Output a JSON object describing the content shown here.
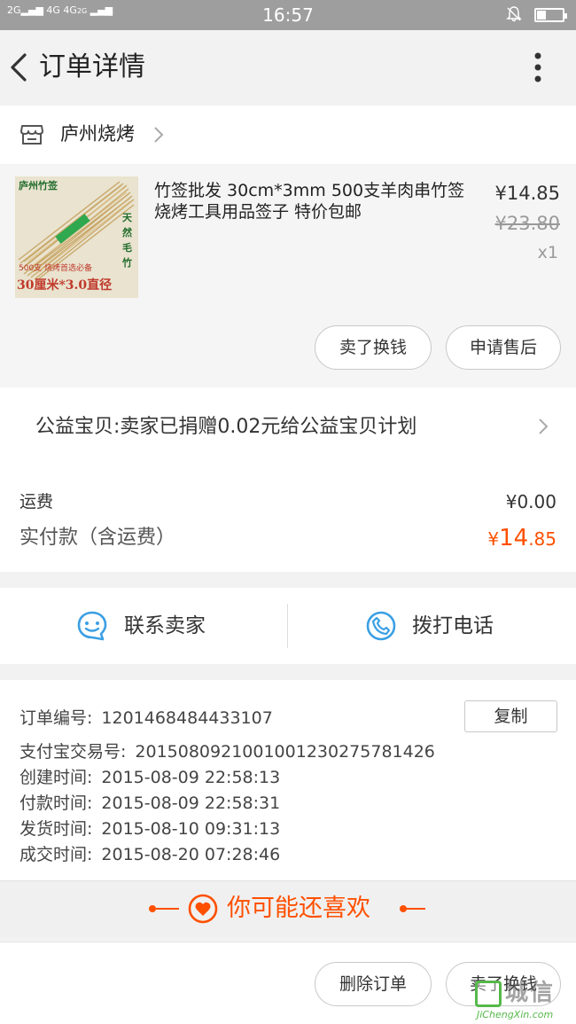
{
  "status_bar": {
    "signal_left": "2G",
    "network": "4G 4G",
    "network_sub": "2G",
    "time": "16:57",
    "battery_level": 0.35
  },
  "header": {
    "title": "订单详情"
  },
  "shop": {
    "name": "庐州烧烤"
  },
  "product": {
    "image_text": {
      "brand": "庐州竹签",
      "side": "天然毛竹",
      "count_line": "500支  烧烤首选必备",
      "size_line": "30厘米*3.0直径"
    },
    "name": "竹签批发 30cm*3mm 500支羊肉串竹签烧烤工具用品签子 特价包邮",
    "price": "¥14.85",
    "original_price": "¥23.80",
    "quantity": "x1",
    "buttons": {
      "sell": "卖了换钱",
      "after_sale": "申请售后"
    }
  },
  "charity": {
    "text": "公益宝贝:卖家已捐赠0.02元给公益宝贝计划"
  },
  "fees": {
    "shipping_label": "运费",
    "shipping_value": "¥0.00",
    "paid_label": "实付款（含运费）",
    "paid_symbol": "¥",
    "paid_int": "14",
    "paid_dec": ".85"
  },
  "contact": {
    "seller": "联系卖家",
    "call": "拨打电话"
  },
  "order_info": {
    "copy_label": "复制",
    "rows": [
      {
        "key": "订单编号:",
        "value": "1201468484433107"
      },
      {
        "key": "支付宝交易号:",
        "value": "2015080921001001230275781426"
      },
      {
        "key": "创建时间:",
        "value": "2015-08-09 22:58:13"
      },
      {
        "key": "付款时间:",
        "value": "2015-08-09 22:58:31"
      },
      {
        "key": "发货时间:",
        "value": "2015-08-10 09:31:13"
      },
      {
        "key": "成交时间:",
        "value": "2015-08-20 07:28:46"
      }
    ]
  },
  "recommend": {
    "text": "你可能还喜欢"
  },
  "bottom": {
    "delete": "删除订单",
    "sell": "卖了换钱"
  },
  "watermark": {
    "text": "城信",
    "sub": "JiChengXin.com"
  },
  "colors": {
    "accent": "#ff5000",
    "icon_blue": "#3b9fe3",
    "status_bar": "#9e9e9e"
  }
}
